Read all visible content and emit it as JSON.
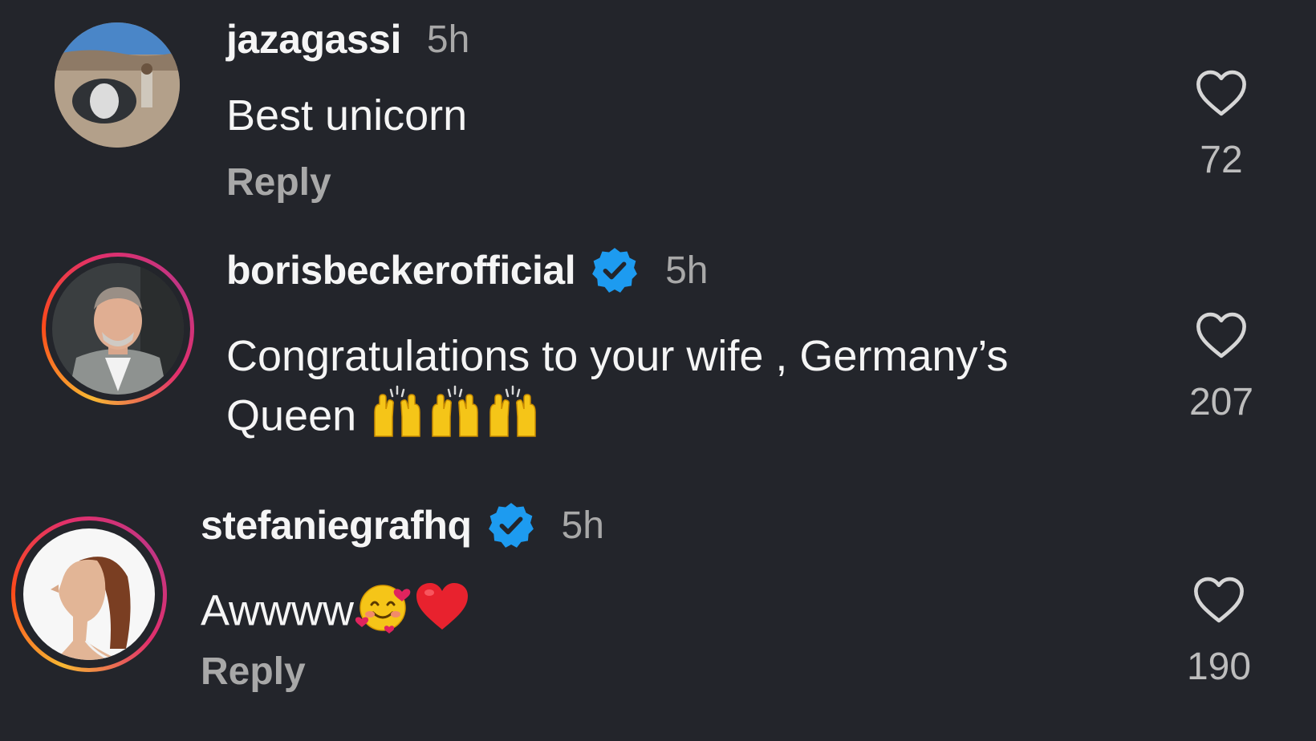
{
  "comments": [
    {
      "username": "jazagassi",
      "time": "5h",
      "text": "Best unicorn",
      "reply_label": "Reply",
      "likes": "72",
      "verified": false,
      "avatar_ring": false
    },
    {
      "username": "borisbeckerofficial",
      "time": "5h",
      "text": "Congratulations to your wife , Germany’s Queen",
      "emojis": [
        "raising-hands-icon",
        "raising-hands-icon",
        "raising-hands-icon"
      ],
      "likes": "207",
      "verified": true,
      "avatar_ring": true
    },
    {
      "username": "stefaniegrafhq",
      "time": "5h",
      "text": "Awwww",
      "emojis": [
        "smiling-face-with-hearts-icon",
        "red-heart-icon"
      ],
      "reply_label": "Reply",
      "likes": "190",
      "verified": true,
      "avatar_ring": true
    }
  ],
  "colors": {
    "background": "#23252b",
    "verified_badge": "#1d9bf0",
    "muted_text": "#a8a8a8",
    "emoji_yellow": "#f5c518"
  }
}
